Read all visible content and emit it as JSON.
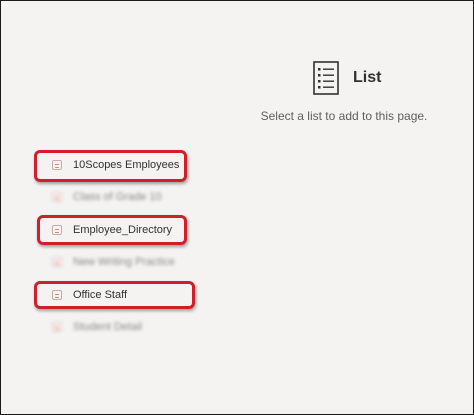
{
  "panel": {
    "title": "List",
    "icon": "list-document-icon",
    "subtitle": "Select a list to add to this page."
  },
  "lists": [
    {
      "label": "10Scopes Employees",
      "icon": "list-icon",
      "highlighted": true,
      "blurred": false
    },
    {
      "label": "Class of Grade 10",
      "icon": "list-icon",
      "highlighted": false,
      "blurred": true
    },
    {
      "label": "Employee_Directory",
      "icon": "list-icon",
      "highlighted": true,
      "blurred": false
    },
    {
      "label": "New Writing Practice",
      "icon": "list-icon",
      "highlighted": false,
      "blurred": true
    },
    {
      "label": "Office Staff",
      "icon": "list-icon",
      "highlighted": true,
      "blurred": false
    },
    {
      "label": "Student Detail",
      "icon": "list-icon",
      "highlighted": false,
      "blurred": true
    }
  ],
  "colors": {
    "background": "#f4f3f2",
    "highlight": "#d01f2b",
    "text": "#323130",
    "muted_text": "#605e5c"
  }
}
